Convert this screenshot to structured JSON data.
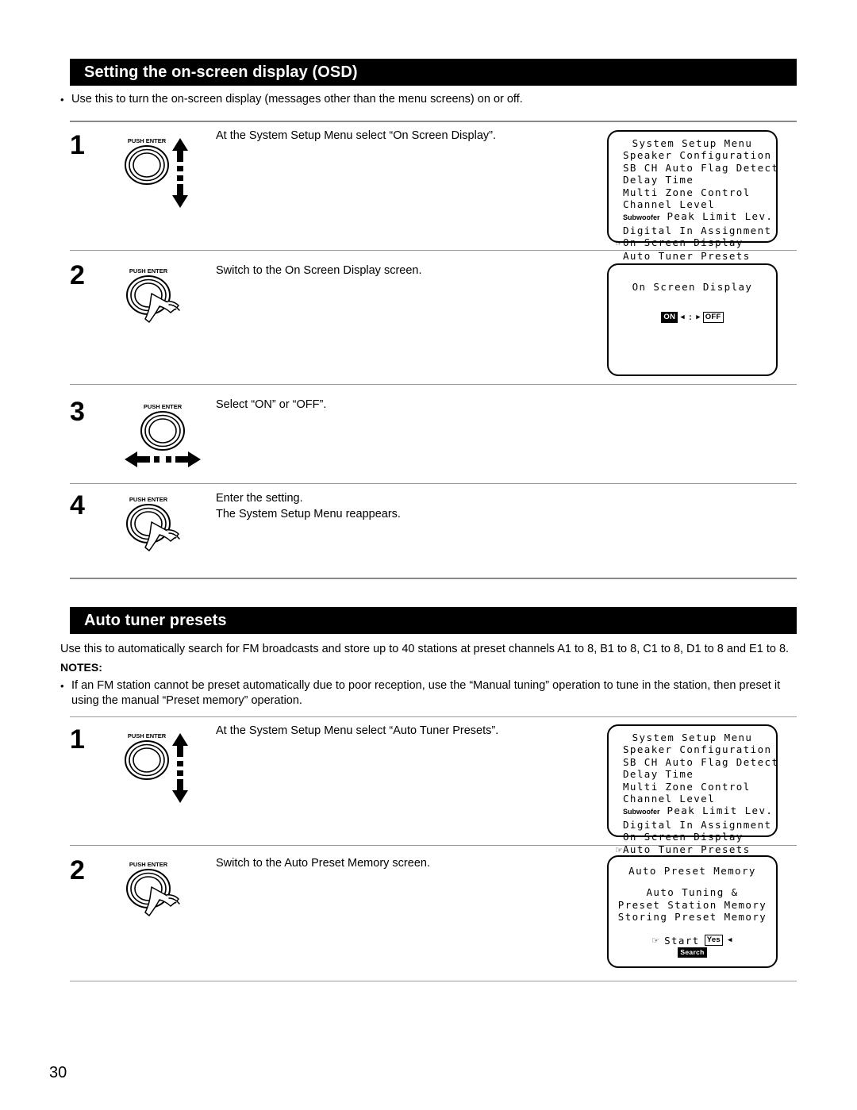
{
  "page": {
    "number": "30"
  },
  "sections": {
    "osd": {
      "title": "Setting the on-screen display (OSD)",
      "intro_bullet": "Use this to turn the on-screen display (messages other than the menu screens) on or off.",
      "steps": [
        {
          "number": "1",
          "text": "At the System Setup Menu select “On Screen Display”.",
          "control": "push-enter-knob-up-down"
        },
        {
          "number": "2",
          "text": "Switch to the On Screen Display screen.",
          "control": "push-enter-knob-press"
        },
        {
          "number": "3",
          "text": "Select “ON” or “OFF”.",
          "control": "push-enter-knob-left-right"
        },
        {
          "number": "4",
          "text": "Enter the setting.\nThe System Setup Menu reappears.",
          "control": "push-enter-knob-press"
        }
      ]
    },
    "tuner": {
      "title": "Auto tuner presets",
      "intro": "Use this to automatically search for FM broadcasts and store up to 40 stations at preset channels A1 to 8, B1 to 8, C1 to 8, D1 to 8 and E1 to 8.",
      "notes_label": "NOTES:",
      "notes_bullet": "If an FM station cannot be preset automatically due to poor reception, use the “Manual tuning” operation to tune in the station, then preset it using the manual “Preset memory” operation.",
      "steps": [
        {
          "number": "1",
          "text": "At the System Setup Menu select “Auto Tuner Presets”.",
          "control": "push-enter-knob-up-down"
        },
        {
          "number": "2",
          "text": "Switch to the Auto Preset Memory screen.",
          "control": "push-enter-knob-press"
        }
      ]
    }
  },
  "knob": {
    "label": "PUSH ENTER"
  },
  "lcd_panels": {
    "system_setup_osd": {
      "title": "System Setup Menu",
      "items": [
        {
          "label": "Speaker Configuration",
          "selected": false
        },
        {
          "label": "SB CH Auto Flag Detect",
          "selected": false
        },
        {
          "label": "Delay Time",
          "selected": false
        },
        {
          "label": "Multi Zone Control",
          "selected": false
        },
        {
          "label": "Channel Level",
          "selected": false
        },
        {
          "label": "Peak Limit Lev.",
          "prefix": "Subwoofer",
          "selected": false
        },
        {
          "label": "Digital In Assignment",
          "selected": false
        },
        {
          "label": "On Screen Display",
          "selected": true
        },
        {
          "label": "Auto Tuner Presets",
          "selected": false
        }
      ]
    },
    "on_screen_display": {
      "title": "On Screen Display",
      "option_on": "ON",
      "option_off": "OFF",
      "separator": ":",
      "selected": "ON",
      "left_arrow": "◀",
      "right_arrow": "▶"
    },
    "system_setup_tuner": {
      "title": "System Setup Menu",
      "items": [
        {
          "label": "Speaker Configuration",
          "selected": false
        },
        {
          "label": "SB CH Auto Flag Detect",
          "selected": false
        },
        {
          "label": "Delay Time",
          "selected": false
        },
        {
          "label": "Multi Zone Control",
          "selected": false
        },
        {
          "label": "Channel Level",
          "selected": false
        },
        {
          "label": "Peak Limit Lev.",
          "prefix": "Subwoofer",
          "selected": false
        },
        {
          "label": "Digital In Assignment",
          "selected": false
        },
        {
          "label": "On Screen Display",
          "selected": false
        },
        {
          "label": "Auto Tuner Presets",
          "selected": true
        }
      ]
    },
    "auto_preset_memory": {
      "title": "Auto Preset Memory",
      "line1": "Auto Tuning &",
      "line2": "Preset Station Memory",
      "line3": "Storing Preset Memory",
      "start_label": "Start",
      "start_value": "Yes",
      "start_arrow": "◀",
      "search_label": "Search"
    }
  },
  "colors": {
    "bar_background": "#000000",
    "bar_text": "#ffffff",
    "rule": "#8a8a8a",
    "page_background": "#ffffff"
  }
}
